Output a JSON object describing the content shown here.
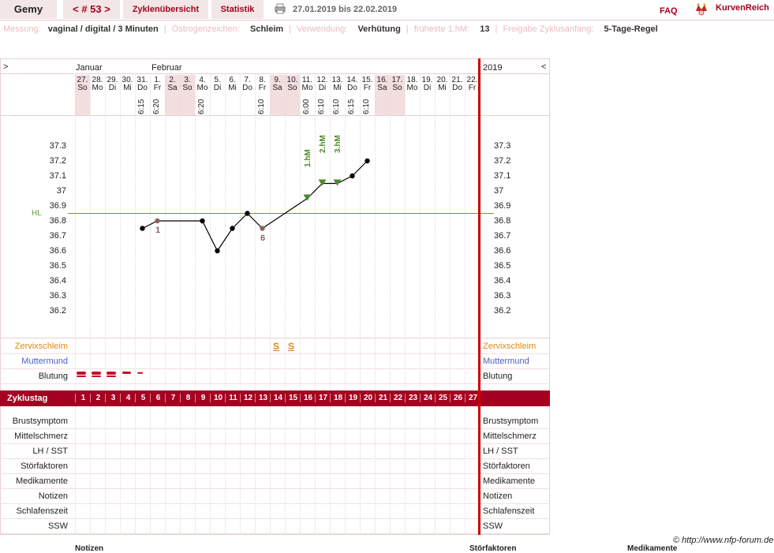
{
  "header": {
    "user": "Gemy",
    "cycle_nav": "< # 53 >",
    "tab_overview": "Zyklenübersicht",
    "tab_stats": "Statistik",
    "date_range": "27.01.2019 bis 22.02.2019",
    "faq": "FAQ",
    "logo": "KurvenReich"
  },
  "meta": {
    "messung_label": "Messung:",
    "messung_value": "vaginal / digital / 3 Minuten",
    "oestrogen_label": "Östrogenzeichen:",
    "oestrogen_value": "Schleim",
    "verwendung_label": "Verwendung:",
    "verwendung_value": "Verhütung",
    "hm_label": "früheste 1.hM:",
    "hm_value": "13",
    "freigabe_label": "Freigabe Zyklusanfang:",
    "freigabe_value": "5-Tage-Regel"
  },
  "chart_header": {
    "left_arrow": ">",
    "right_arrow": "<",
    "month1": "Januar",
    "month2": "Februar",
    "year": "2019"
  },
  "days": [
    {
      "d": "27.",
      "w": "So",
      "t": "",
      "we": true
    },
    {
      "d": "28.",
      "w": "Mo",
      "t": "",
      "we": false
    },
    {
      "d": "29.",
      "w": "Di",
      "t": "",
      "we": false
    },
    {
      "d": "30.",
      "w": "Mi",
      "t": "",
      "we": false
    },
    {
      "d": "31.",
      "w": "Do",
      "t": "6:15",
      "we": false
    },
    {
      "d": "1.",
      "w": "Fr",
      "t": "6:20",
      "we": false
    },
    {
      "d": "2.",
      "w": "Sa",
      "t": "",
      "we": true
    },
    {
      "d": "3.",
      "w": "So",
      "t": "",
      "we": true
    },
    {
      "d": "4.",
      "w": "Mo",
      "t": "6:20",
      "we": false
    },
    {
      "d": "5.",
      "w": "Di",
      "t": "",
      "we": false
    },
    {
      "d": "6.",
      "w": "Mi",
      "t": "",
      "we": false
    },
    {
      "d": "7.",
      "w": "Do",
      "t": "",
      "we": false
    },
    {
      "d": "8.",
      "w": "Fr",
      "t": "6:10",
      "we": false
    },
    {
      "d": "9.",
      "w": "Sa",
      "t": "",
      "we": true
    },
    {
      "d": "10.",
      "w": "So",
      "t": "",
      "we": true
    },
    {
      "d": "11.",
      "w": "Mo",
      "t": "6:00",
      "we": false
    },
    {
      "d": "12.",
      "w": "Di",
      "t": "6:10",
      "we": false
    },
    {
      "d": "13.",
      "w": "Mi",
      "t": "6:10",
      "we": false
    },
    {
      "d": "14.",
      "w": "Do",
      "t": "6:15",
      "we": false
    },
    {
      "d": "15.",
      "w": "Fr",
      "t": "6:10",
      "we": false
    },
    {
      "d": "16.",
      "w": "Sa",
      "t": "",
      "we": true
    },
    {
      "d": "17.",
      "w": "So",
      "t": "",
      "we": true
    },
    {
      "d": "18.",
      "w": "Mo",
      "t": "",
      "we": false
    },
    {
      "d": "19.",
      "w": "Di",
      "t": "",
      "we": false
    },
    {
      "d": "20.",
      "w": "Mi",
      "t": "",
      "we": false
    },
    {
      "d": "21.",
      "w": "Do",
      "t": "",
      "we": false
    },
    {
      "d": "22.",
      "w": "Fr",
      "t": "",
      "we": false
    }
  ],
  "temp_ticks": [
    "37.3",
    "37.2",
    "37.1",
    "37",
    "36.9",
    "36.8",
    "36.7",
    "36.6",
    "36.5",
    "36.4",
    "36.3",
    "36.2"
  ],
  "hl_label": "HL",
  "markers": {
    "hm1": "1.hM",
    "hm2": "2.hM",
    "hm3": "3.hM",
    "lower1": "1",
    "lower6": "6",
    "mucus": "S"
  },
  "labels": {
    "zervix": "Zervixschleim",
    "muttermund": "Muttermund",
    "blutung": "Blutung",
    "zyklustag": "Zyklustag",
    "brust": "Brustsymptom",
    "mittel": "Mittelschmerz",
    "lh": "LH / SST",
    "stoer": "Störfaktoren",
    "medi": "Medikamente",
    "notizen": "Notizen",
    "schlaf": "Schlafenszeit",
    "ssw": "SSW"
  },
  "cycle_days": [
    "1",
    "2",
    "3",
    "4",
    "5",
    "6",
    "7",
    "8",
    "9",
    "10",
    "11",
    "12",
    "13",
    "14",
    "15",
    "16",
    "17",
    "18",
    "19",
    "20",
    "21",
    "22",
    "23",
    "24",
    "25",
    "26",
    "27"
  ],
  "footer": {
    "copyright": "© http://www.nfp-forum.de",
    "notizen": "Notizen",
    "stoerfaktoren": "Störfaktoren",
    "medikamente": "Medikamente"
  },
  "colors": {
    "accent": "#a50021",
    "cover_line": "#6a9a3a",
    "marker_green": "#4f8a2a",
    "mucus": "#e08a10",
    "muttermund": "#4f5fc0",
    "weekend": "#f2dede"
  },
  "chart_data": {
    "type": "line",
    "x": [
      "31.",
      "1.",
      "4.",
      "5.",
      "6.",
      "7.",
      "8.",
      "11.",
      "12.",
      "13.",
      "14.",
      "15."
    ],
    "values": [
      36.75,
      36.8,
      36.8,
      36.6,
      36.75,
      36.85,
      36.75,
      36.95,
      37.05,
      37.05,
      37.1,
      37.2
    ],
    "ylim": [
      36.2,
      37.3
    ],
    "coverline": 36.85
  }
}
